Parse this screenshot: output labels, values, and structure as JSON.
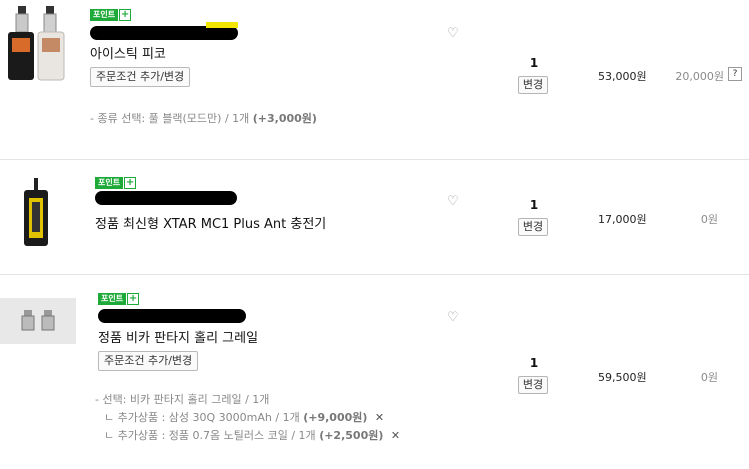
{
  "badge": {
    "label": "포인트",
    "plus": "+"
  },
  "items": [
    {
      "name": "아이스틱 피코",
      "option_button": "주문조건 추가/변경",
      "options": [
        "- 종류 선택: 풀 블랙(모드만) / 1개",
        "(+3,000원)"
      ],
      "qty": "1",
      "change_button": "변경",
      "price": "53,000원",
      "discount": "20,000원",
      "help": "?"
    },
    {
      "name": "정품 최신형 XTAR MC1 Plus Ant 충전기",
      "qty": "1",
      "change_button": "변경",
      "price": "17,000원",
      "discount": "0원"
    },
    {
      "name": "정품 비카 판타지 홀리 그레일",
      "option_button": "주문조건 추가/변경",
      "option_main": "- 선택: 비카 판타지 홀리 그레일 / 1개",
      "extras": [
        {
          "text": "ㄴ 추가상품 : 삼성 30Q 3000mAh / 1개",
          "amount": "(+9,000원)",
          "remove": "✕"
        },
        {
          "text": "ㄴ 추가상품 : 정품 0.7옴 노틸러스 코일 / 1개",
          "amount": "(+2,500원)",
          "remove": "✕"
        }
      ],
      "qty": "1",
      "change_button": "변경",
      "price": "59,500원",
      "discount": "0원"
    }
  ]
}
